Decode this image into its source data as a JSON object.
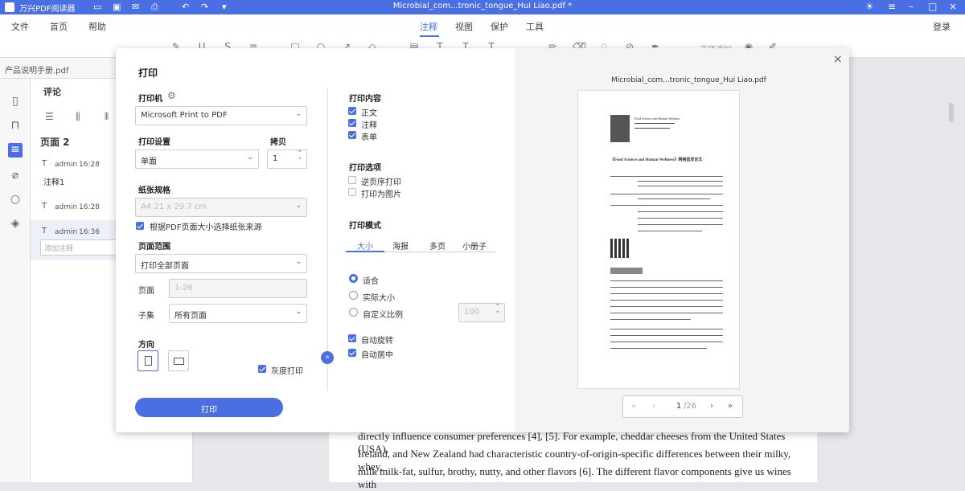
{
  "titlebar": {
    "app_name": "万兴PDF阅读器",
    "document_title": "Microbial_com...tronic_tongue_Hui Liao.pdf *"
  },
  "menubar": {
    "items": [
      "文件",
      "首页",
      "帮助"
    ],
    "tabs": [
      "注释",
      "视图",
      "保护",
      "工具"
    ],
    "active_tab": "注释",
    "login": "登录"
  },
  "toolbar": {
    "hint": "选择添加"
  },
  "filetab": {
    "name": "产品说明手册.pdf"
  },
  "comments": {
    "title": "评论",
    "page_label": "页面 2",
    "items": [
      {
        "user": "admin",
        "time": "16:28",
        "text": "注释1"
      },
      {
        "user": "admin",
        "time": "16:28",
        "text": ""
      },
      {
        "user": "admin",
        "time": "16:36",
        "text": ""
      }
    ],
    "input_placeholder": "添加注释"
  },
  "document_text": [
    "directly influence consumer preferences [4], [5]. For example, cheddar cheeses from the United States (USA),",
    "Ireland, and New Zealand had characteristic country-of-origin-specific differences between their milky, whey,",
    "milk milk-fat, sulfur, brothy, nutty, and other flavors [6]. The different flavor components give us wines with"
  ],
  "dialog": {
    "title": "打印",
    "printer": {
      "label": "打印机",
      "value": "Microsoft Print to PDF"
    },
    "print_settings": {
      "label": "打印设置",
      "value": "单面"
    },
    "copies": {
      "label": "拷贝",
      "value": "1"
    },
    "paper": {
      "label": "纸张规格",
      "value": "A4 21 x 29.7 cm",
      "auto_source": "根据PDF页面大小选择纸张来源",
      "auto_source_checked": true
    },
    "page_range": {
      "label": "页面范围",
      "value": "打印全部页面",
      "pages_label": "页面",
      "pages_placeholder": "1-26",
      "subset_label": "子集",
      "subset_value": "所有页面"
    },
    "orientation": {
      "label": "方向",
      "selected": "portrait"
    },
    "grayscale": {
      "label": "灰度打印",
      "checked": true
    },
    "print_button": "打印",
    "content": {
      "label": "打印内容",
      "options": [
        {
          "label": "正文",
          "checked": true
        },
        {
          "label": "注释",
          "checked": true
        },
        {
          "label": "表单",
          "checked": true
        }
      ]
    },
    "options": {
      "label": "打印选项",
      "items": [
        {
          "label": "逆页序打印",
          "checked": false
        },
        {
          "label": "打印为图片",
          "checked": false
        }
      ]
    },
    "mode": {
      "label": "打印模式",
      "tabs": [
        "大小",
        "海报",
        "多页",
        "小册子"
      ],
      "active": "大小"
    },
    "scale": {
      "options": [
        {
          "label": "适合",
          "selected": true
        },
        {
          "label": "实际大小",
          "selected": false
        },
        {
          "label": "自定义比例",
          "selected": false
        }
      ],
      "custom_value": "100"
    },
    "auto": {
      "items": [
        {
          "label": "自动旋转",
          "checked": true
        },
        {
          "label": "自动居中",
          "checked": true
        }
      ]
    },
    "preview": {
      "filename": "Microbial_com...tronic_tongue_Hui Liao.pdf",
      "current_page": "1",
      "total_pages": "/26",
      "article_heading": "《Food Science and Human Wellness》网络首发论文",
      "journal": "Food Science and Human Wellness"
    }
  }
}
